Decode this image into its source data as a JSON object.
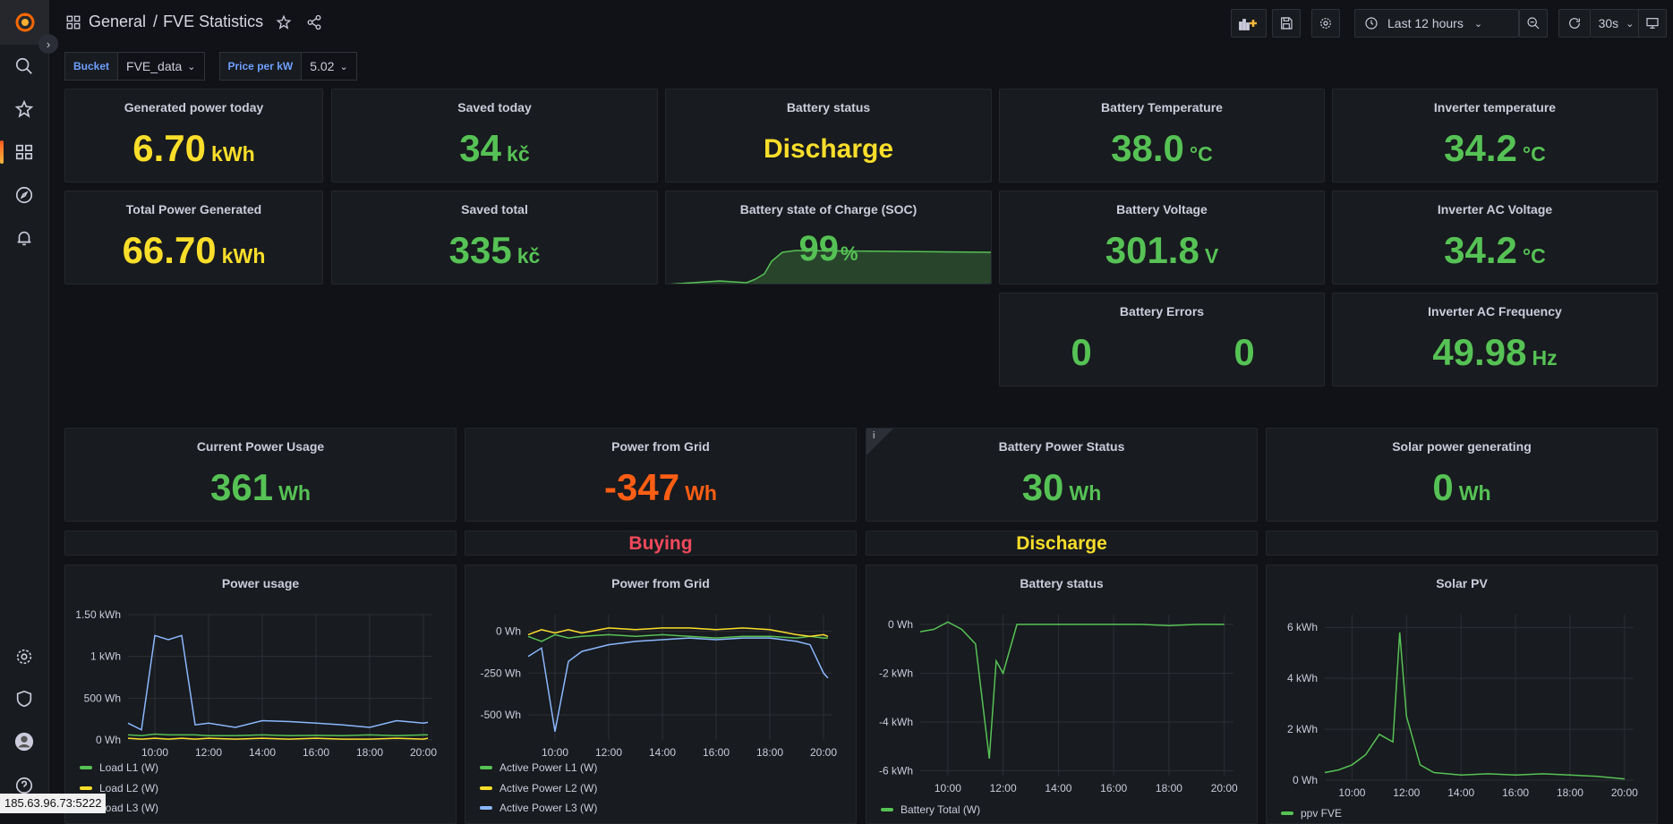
{
  "colors": {
    "yellow": "#fade2a",
    "green": "#56c255",
    "orange": "#ff5e14",
    "red": "#f2495c",
    "blue": "#8ab8ff",
    "grid": "#2c2f36"
  },
  "sidebar": {
    "icons": [
      "grafana-logo-icon",
      "search-icon",
      "star-icon",
      "dashboards-icon",
      "explore-icon",
      "alerting-icon",
      "settings-icon",
      "shield-icon",
      "avatar",
      "help-icon"
    ]
  },
  "breadcrumb": {
    "folder": "General",
    "separator": "/",
    "title": "FVE Statistics"
  },
  "toolbar": {
    "time_range": "Last 12 hours",
    "refresh": "30s"
  },
  "variables": [
    {
      "label": "Bucket",
      "value": "FVE_data"
    },
    {
      "label": "Price per kW",
      "value": "5.02"
    }
  ],
  "stats": {
    "generated_today": {
      "title": "Generated power today",
      "value": "6.70",
      "unit": "kWh"
    },
    "saved_today": {
      "title": "Saved today",
      "value": "34",
      "unit": "kč"
    },
    "battery_status": {
      "title": "Battery status",
      "value": "Discharge"
    },
    "battery_temp": {
      "title": "Battery Temperature",
      "value": "38.0",
      "unit": "°C"
    },
    "inverter_temp": {
      "title": "Inverter temperature",
      "value": "34.2",
      "unit": "°C"
    },
    "total_generated": {
      "title": "Total Power Generated",
      "value": "66.70",
      "unit": "kWh"
    },
    "saved_total": {
      "title": "Saved total",
      "value": "335",
      "unit": "kč"
    },
    "soc": {
      "title": "Battery state of Charge (SOC)",
      "value": "99",
      "unit": "%"
    },
    "battery_voltage": {
      "title": "Battery Voltage",
      "value": "301.8",
      "unit": "V"
    },
    "inverter_ac_voltage": {
      "title": "Inverter AC Voltage",
      "value": "34.2",
      "unit": "°C"
    },
    "battery_errors": {
      "title": "Battery Errors",
      "value_a": "0",
      "value_b": "0"
    },
    "inverter_ac_freq": {
      "title": "Inverter AC Frequency",
      "value": "49.98",
      "unit": "Hz"
    },
    "current_usage": {
      "title": "Current Power Usage",
      "value": "361",
      "unit": "Wh"
    },
    "power_from_grid": {
      "title": "Power from Grid",
      "value": "-347",
      "unit": "Wh"
    },
    "battery_power": {
      "title": "Battery Power Status",
      "value": "30",
      "unit": "Wh",
      "info": "i"
    },
    "solar_generating": {
      "title": "Solar power generating",
      "value": "0",
      "unit": "Wh"
    }
  },
  "status_text": {
    "grid": "Buying",
    "battery": "Discharge"
  },
  "chart_data": [
    {
      "type": "line",
      "title": "Power usage",
      "x": [
        "09:00",
        "09:30",
        "10:00",
        "10:30",
        "11:00",
        "11:30",
        "12:00",
        "13:00",
        "14:00",
        "15:00",
        "16:00",
        "17:00",
        "18:00",
        "19:00",
        "20:00",
        "20:10"
      ],
      "yticks": [
        "0 Wh",
        "500 Wh",
        "1 kWh",
        "1.50 kWh"
      ],
      "xticks": [
        "10:00",
        "12:00",
        "14:00",
        "16:00",
        "18:00",
        "20:00"
      ],
      "ylim": [
        0,
        1500
      ],
      "series": [
        {
          "name": "Load L1 (W)",
          "color": "#56c255",
          "values": [
            60,
            50,
            70,
            60,
            60,
            60,
            50,
            50,
            60,
            50,
            55,
            50,
            60,
            50,
            60,
            60
          ]
        },
        {
          "name": "Load L2 (W)",
          "color": "#fade2a",
          "values": [
            20,
            10,
            20,
            10,
            20,
            10,
            20,
            10,
            20,
            10,
            20,
            10,
            10,
            20,
            10,
            20
          ]
        },
        {
          "name": "Load L3 (W)",
          "color": "#8ab8ff",
          "values": [
            200,
            120,
            1250,
            1200,
            1250,
            180,
            200,
            150,
            230,
            220,
            200,
            180,
            150,
            230,
            200,
            210
          ]
        }
      ]
    },
    {
      "type": "line",
      "title": "Power from Grid",
      "x": [
        "09:00",
        "09:30",
        "10:00",
        "10:30",
        "11:00",
        "12:00",
        "13:00",
        "14:00",
        "15:00",
        "16:00",
        "17:00",
        "18:00",
        "19:00",
        "19:30",
        "20:00",
        "20:10"
      ],
      "yticks": [
        "-500 Wh",
        "-250 Wh",
        "0 Wh"
      ],
      "xticks": [
        "10:00",
        "12:00",
        "14:00",
        "16:00",
        "18:00",
        "20:00"
      ],
      "ylim": [
        -650,
        100
      ],
      "series": [
        {
          "name": "Active Power L1 (W)",
          "color": "#56c255",
          "values": [
            -30,
            -60,
            -20,
            -40,
            -30,
            -20,
            -30,
            -20,
            -30,
            -40,
            -30,
            -30,
            -40,
            -30,
            -40,
            -40
          ]
        },
        {
          "name": "Active Power L2 (W)",
          "color": "#fade2a",
          "values": [
            -20,
            10,
            -10,
            10,
            -10,
            20,
            10,
            20,
            20,
            10,
            20,
            10,
            -20,
            -30,
            -20,
            -30
          ]
        },
        {
          "name": "Active Power L3 (W)",
          "color": "#8ab8ff",
          "values": [
            -150,
            -100,
            -600,
            -180,
            -120,
            -80,
            -60,
            -50,
            -40,
            -50,
            -40,
            -40,
            -60,
            -80,
            -250,
            -280
          ]
        }
      ]
    },
    {
      "type": "line",
      "title": "Battery status",
      "x": [
        "09:00",
        "09:30",
        "10:00",
        "10:30",
        "11:00",
        "11:30",
        "11:45",
        "12:00",
        "12:30",
        "13:00",
        "14:00",
        "15:00",
        "16:00",
        "17:00",
        "18:00",
        "19:00",
        "20:00"
      ],
      "yticks": [
        "-6 kWh",
        "-4 kWh",
        "-2 kWh",
        "0 Wh"
      ],
      "xticks": [
        "10:00",
        "12:00",
        "14:00",
        "16:00",
        "18:00",
        "20:00"
      ],
      "ylim": [
        -6200,
        400
      ],
      "series": [
        {
          "name": "Battery Total (W)",
          "color": "#56c255",
          "values": [
            -300,
            -200,
            100,
            -200,
            -800,
            -5500,
            -1500,
            -2000,
            0,
            0,
            0,
            0,
            0,
            0,
            -50,
            0,
            0
          ]
        }
      ]
    },
    {
      "type": "line",
      "title": "Solar PV",
      "x": [
        "09:00",
        "09:30",
        "10:00",
        "10:30",
        "11:00",
        "11:30",
        "11:45",
        "12:00",
        "12:30",
        "13:00",
        "14:00",
        "15:00",
        "16:00",
        "17:00",
        "18:00",
        "19:00",
        "20:00"
      ],
      "yticks": [
        "0 Wh",
        "2 kWh",
        "4 kWh",
        "6 kWh"
      ],
      "xticks": [
        "10:00",
        "12:00",
        "14:00",
        "16:00",
        "18:00",
        "20:00"
      ],
      "ylim": [
        0,
        6500
      ],
      "series": [
        {
          "name": "ppv FVE",
          "color": "#56c255",
          "values": [
            300,
            400,
            600,
            1000,
            1800,
            1500,
            5800,
            2500,
            600,
            300,
            200,
            250,
            200,
            250,
            200,
            150,
            50
          ]
        }
      ]
    }
  ]
}
